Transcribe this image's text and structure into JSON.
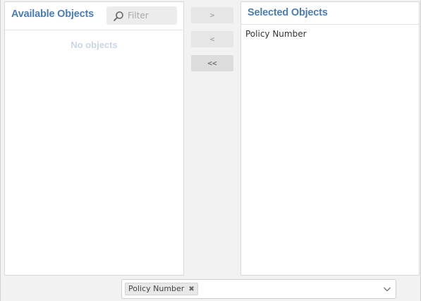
{
  "available": {
    "title": "Available Objects",
    "filter_placeholder": "Filter",
    "empty_message": "No objects"
  },
  "selected": {
    "title": "Selected Objects",
    "items": [
      "Policy Number"
    ]
  },
  "buttons": {
    "move_right": ">",
    "move_left": "<",
    "move_all_left": "<<"
  },
  "selection_field": {
    "tags": [
      "Policy Number"
    ],
    "remove_glyph": "✖"
  },
  "colors": {
    "title": "#4a7db8",
    "empty_message": "#c9d6e6"
  },
  "icons": {
    "filter": "search-icon",
    "dropdown": "chevron-down-icon",
    "remove": "close-icon"
  }
}
